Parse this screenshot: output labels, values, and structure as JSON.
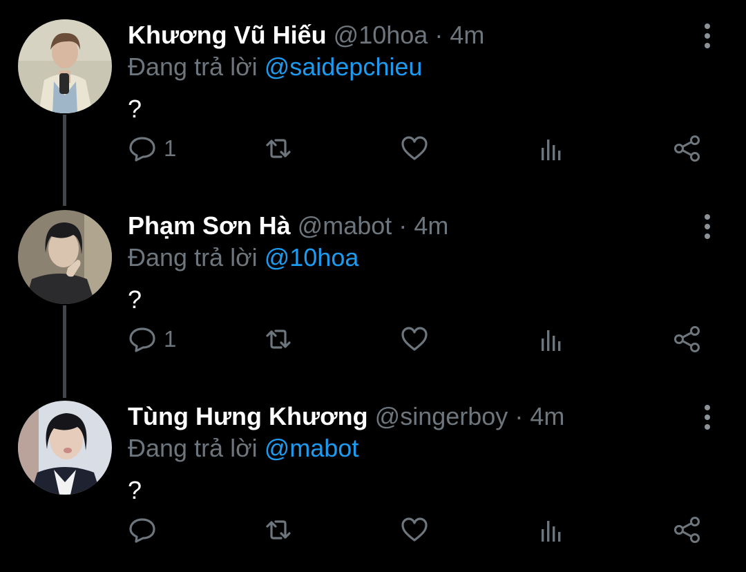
{
  "colors": {
    "background": "#000000",
    "text_primary": "#ffffff",
    "text_secondary": "#6e767d",
    "mention": "#1d9bf0",
    "thread_line": "#42464b"
  },
  "tweets": [
    {
      "name": "Khương Vũ Hiếu",
      "handle": "@10hoa",
      "separator": "·",
      "time": "4m",
      "replying_prefix": "Đang trả lời",
      "replying_to": "@saidepchieu",
      "text": "?",
      "reply_count": "1",
      "icons": [
        "reply-icon",
        "retweet-icon",
        "like-icon",
        "analytics-icon",
        "share-icon",
        "more-options-icon"
      ]
    },
    {
      "name": "Phạm Sơn Hà",
      "handle": "@mabot",
      "separator": "·",
      "time": "4m",
      "replying_prefix": "Đang trả lời",
      "replying_to": "@10hoa",
      "text": "?",
      "reply_count": "1",
      "icons": [
        "reply-icon",
        "retweet-icon",
        "like-icon",
        "analytics-icon",
        "share-icon",
        "more-options-icon"
      ]
    },
    {
      "name": "Tùng Hưng Khương",
      "handle": "@singerboy",
      "separator": "·",
      "time": "4m",
      "replying_prefix": "Đang trả lời",
      "replying_to": "@mabot",
      "text": "?",
      "reply_count": "",
      "icons": [
        "reply-icon",
        "retweet-icon",
        "like-icon",
        "analytics-icon",
        "share-icon",
        "more-options-icon"
      ]
    }
  ]
}
